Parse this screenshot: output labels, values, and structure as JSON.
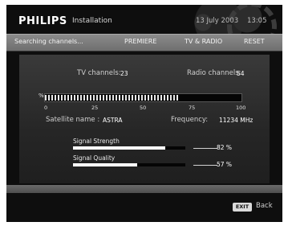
{
  "header": {
    "brand": "PHILIPS",
    "menu_title": "Installation",
    "date": "13 July 2003",
    "time": "13:05"
  },
  "tabs": {
    "status": "Searching channels...",
    "premiere": "PREMIERE",
    "tv_radio": "TV & RADIO",
    "reset": "RESET"
  },
  "scan": {
    "tv_channels_label": "TV channels:",
    "tv_channels_value": "23",
    "radio_channels_label": "Radio channels:",
    "radio_channels_value": "54",
    "percent_sign": "%",
    "progress_percent": 68,
    "ticks": [
      "0",
      "25",
      "50",
      "75",
      "100"
    ],
    "satellite_label": "Satellite name :",
    "satellite_value": "ASTRA",
    "frequency_label": "Frequency:",
    "frequency_value": "11234 MHz"
  },
  "signal": {
    "strength_label": "Signal Strength",
    "strength_value": "82 %",
    "strength_percent": 82,
    "quality_label": "Signal Quality",
    "quality_value": "57 %",
    "quality_percent": 57
  },
  "footer": {
    "exit_key": "EXIT",
    "back_label": "Back"
  }
}
